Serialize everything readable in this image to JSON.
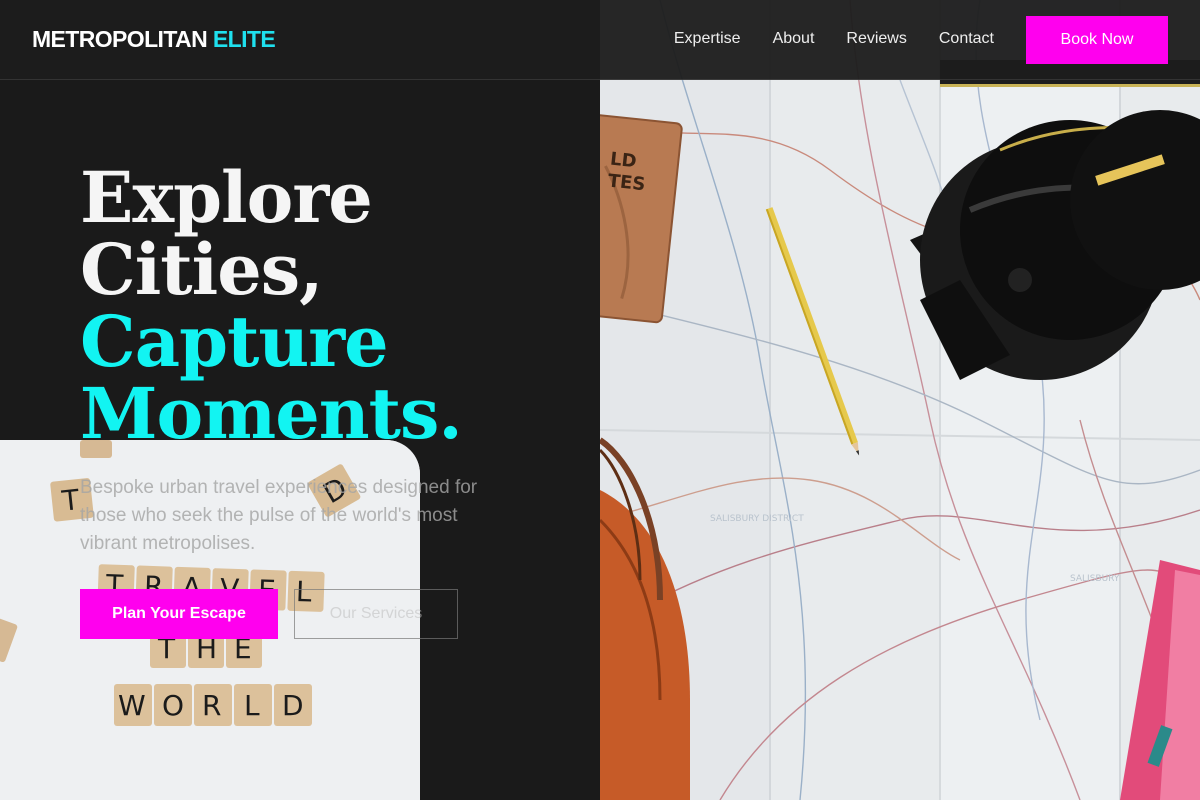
{
  "header": {
    "logo_main": "METROPOLITAN",
    "logo_accent": "ELITE",
    "nav": [
      {
        "label": "Expertise"
      },
      {
        "label": "About"
      },
      {
        "label": "Reviews"
      },
      {
        "label": "Contact"
      }
    ],
    "book_label": "Book Now"
  },
  "hero": {
    "headline_line1": "Explore",
    "headline_line2": "Cities,",
    "headline_line3": "Capture",
    "headline_line4": "Moments.",
    "subtitle": "Bespoke urban travel experiences designed for those who seek the pulse of the world's most vibrant metropolises.",
    "cta_primary": "Plan Your Escape",
    "cta_secondary": "Our Services"
  },
  "photo_tiles": {
    "row1": [
      "T",
      "R",
      "A",
      "V",
      "E",
      "L"
    ],
    "row2": [
      "T",
      "H",
      "E"
    ],
    "row3": [
      "W",
      "O",
      "R",
      "L",
      "D"
    ],
    "loose": [
      "T",
      "D"
    ]
  },
  "colors": {
    "accent_magenta": "#ff00ee",
    "accent_cyan": "#12f4f2",
    "background": "#1a1a1a"
  }
}
